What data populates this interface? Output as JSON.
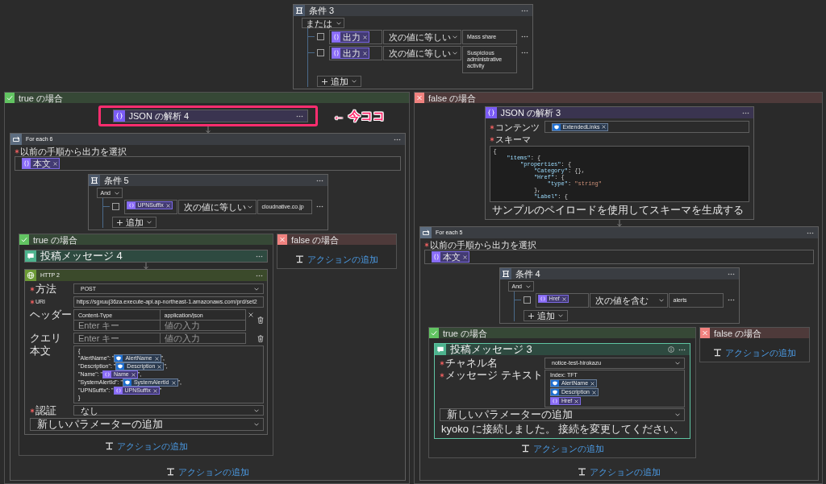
{
  "condition_3": {
    "title": "条件 3",
    "group_operator": "または",
    "rows": [
      {
        "checked": false,
        "operand": [
          {
            "kind": "variable",
            "label": "出力"
          }
        ],
        "comparison": "次の値に等しい",
        "value": "Mass share"
      },
      {
        "checked": false,
        "operand": [
          {
            "kind": "variable",
            "label": "出力"
          }
        ],
        "comparison": "次の値に等しい",
        "value": "Suspicious administrative activity"
      }
    ],
    "add_button": "追加"
  },
  "true_branch": {
    "kind": "true",
    "title": "true の場合",
    "parse_json_4": {
      "title": "JSON の解析 4",
      "highlighted": true
    },
    "annotation": "← 今ココ",
    "for_each_6": {
      "title": "For each 6",
      "input": {
        "label": "以前の手順から出力を選択",
        "required": true,
        "tokens": [
          {
            "kind": "variable",
            "label": "本文"
          }
        ]
      },
      "condition_5": {
        "title": "条件 5",
        "group_operator": "And",
        "rows": [
          {
            "checked": false,
            "operand": [
              {
                "kind": "variable",
                "label": "UPNSuffix"
              }
            ],
            "comparison": "次の値に等しい",
            "value": "cloudnative.co.jp"
          }
        ],
        "add_button": "追加"
      },
      "true_branch": {
        "kind": "true",
        "title": "true の場合",
        "post_message_4": {
          "title": "投稿メッセージ 4"
        },
        "http_2": {
          "title": "HTTP 2",
          "fields": [
            {
              "kind": "select",
              "label": "方法",
              "required": true,
              "value": "POST"
            },
            {
              "kind": "text",
              "label": "URI",
              "required": true,
              "value": "https://sgxuuj36za.execute-api.ap-northeast-1.amazonaws.com/prd/set2"
            },
            {
              "kind": "pairs",
              "label": "ヘッダー",
              "required": false,
              "rows": [
                {
                  "key": {
                    "value": "Content-Type"
                  },
                  "value": {
                    "value": "application/json"
                  }
                },
                {
                  "key": {
                    "placeholder": "Enter キー"
                  },
                  "value": {
                    "placeholder": "値の入力"
                  }
                }
              ]
            },
            {
              "kind": "pairs",
              "label": "クエリ",
              "required": false,
              "rows": [
                {
                  "key": {
                    "placeholder": "Enter キー"
                  },
                  "value": {
                    "placeholder": "値の入力"
                  }
                }
              ]
            },
            {
              "kind": "body",
              "label": "本文",
              "required": false,
              "lines": [
                [
                  {
                    "kind": "text",
                    "text": "{"
                  }
                ],
                [
                  {
                    "kind": "text",
                    "text": "\"AlertName\": \""
                  },
                  {
                    "kind": "alert",
                    "label": "AlertName"
                  },
                  {
                    "kind": "text",
                    "text": "\","
                  }
                ],
                [
                  {
                    "kind": "text",
                    "text": "\"Description\": \""
                  },
                  {
                    "kind": "alert",
                    "label": "Description"
                  },
                  {
                    "kind": "text",
                    "text": "\","
                  }
                ],
                [
                  {
                    "kind": "text",
                    "text": "\"Name\": \""
                  },
                  {
                    "kind": "variable",
                    "label": "Name"
                  },
                  {
                    "kind": "text",
                    "text": "\","
                  }
                ],
                [
                  {
                    "kind": "text",
                    "text": "\"SystemAlertId\": \""
                  },
                  {
                    "kind": "alert",
                    "label": "SystemAlertId"
                  },
                  {
                    "kind": "text",
                    "text": "\","
                  }
                ],
                [
                  {
                    "kind": "text",
                    "text": "\"UPNSuffix\": \""
                  },
                  {
                    "kind": "variable",
                    "label": "UPNSuffix"
                  },
                  {
                    "kind": "text",
                    "text": "\""
                  }
                ],
                [
                  {
                    "kind": "text",
                    "text": "}"
                  }
                ]
              ]
            },
            {
              "kind": "select",
              "label": "認証",
              "required": true,
              "value": "なし"
            }
          ],
          "add_parameter": "新しいパラメーターの追加"
        },
        "add_action": "アクションの追加"
      },
      "false_branch": {
        "kind": "false",
        "title": "false の場合",
        "add_action": "アクションの追加"
      },
      "add_action": "アクションの追加"
    }
  },
  "false_branch": {
    "kind": "false",
    "title": "false の場合",
    "parse_json_3": {
      "title": "JSON の解析 3",
      "content": {
        "label": "コンテンツ",
        "required": true,
        "tokens": [
          {
            "kind": "alert",
            "label": "ExtendedLinks"
          }
        ]
      },
      "schema": {
        "label": "スキーマ",
        "required": true,
        "lines": [
          [
            {
              "kind": "punct",
              "text": "{"
            }
          ],
          [
            {
              "kind": "key",
              "text": "    \"items\""
            },
            {
              "kind": "punct",
              "text": ": {"
            }
          ],
          [
            {
              "kind": "key",
              "text": "        \"properties\""
            },
            {
              "kind": "punct",
              "text": ": {"
            }
          ],
          [
            {
              "kind": "key",
              "text": "            \"Category\""
            },
            {
              "kind": "punct",
              "text": ": {},"
            }
          ],
          [
            {
              "kind": "key",
              "text": "            \"Href\""
            },
            {
              "kind": "punct",
              "text": ": {"
            }
          ],
          [
            {
              "kind": "key",
              "text": "                \"type\""
            },
            {
              "kind": "punct",
              "text": ": "
            },
            {
              "kind": "string",
              "text": "\"string\""
            }
          ],
          [
            {
              "kind": "punct",
              "text": "            },"
            }
          ],
          [
            {
              "kind": "key",
              "text": "            \"Label\""
            },
            {
              "kind": "punct",
              "text": ": {"
            }
          ]
        ]
      },
      "sample_link": "サンプルのペイロードを使用してスキーマを生成する"
    },
    "for_each_5": {
      "title": "For each 5",
      "input": {
        "label": "以前の手順から出力を選択",
        "required": true,
        "tokens": [
          {
            "kind": "variable",
            "label": "本文"
          }
        ]
      },
      "condition_4": {
        "title": "条件 4",
        "group_operator": "And",
        "rows": [
          {
            "checked": false,
            "operand": [
              {
                "kind": "variable",
                "label": "Href"
              }
            ],
            "comparison": "次の値を含む",
            "value": "alerts"
          }
        ],
        "add_button": "追加"
      },
      "true_branch": {
        "kind": "true",
        "title": "true の場合",
        "post_message_3": {
          "title": "投稿メッセージ 3",
          "focused": true,
          "channel": {
            "label": "チャネル名",
            "required": true,
            "value": "notice-test-hirokazu"
          },
          "message": {
            "label": "メッセージ テキスト",
            "required": true,
            "parts": [
              {
                "kind": "text",
                "text": "Index: TFT"
              },
              {
                "kind": "alert",
                "label": "AlertName"
              },
              {
                "kind": "alert",
                "label": "Description"
              },
              {
                "kind": "variable",
                "label": "Href"
              }
            ]
          },
          "add_parameter": "新しいパラメーターの追加",
          "connection": "kyoko に接続しました。 接続を変更してください。"
        },
        "add_action": "アクションの追加"
      },
      "false_branch": {
        "kind": "false",
        "title": "false の場合",
        "add_action": "アクションの追加"
      },
      "add_action": "アクションの追加"
    }
  }
}
